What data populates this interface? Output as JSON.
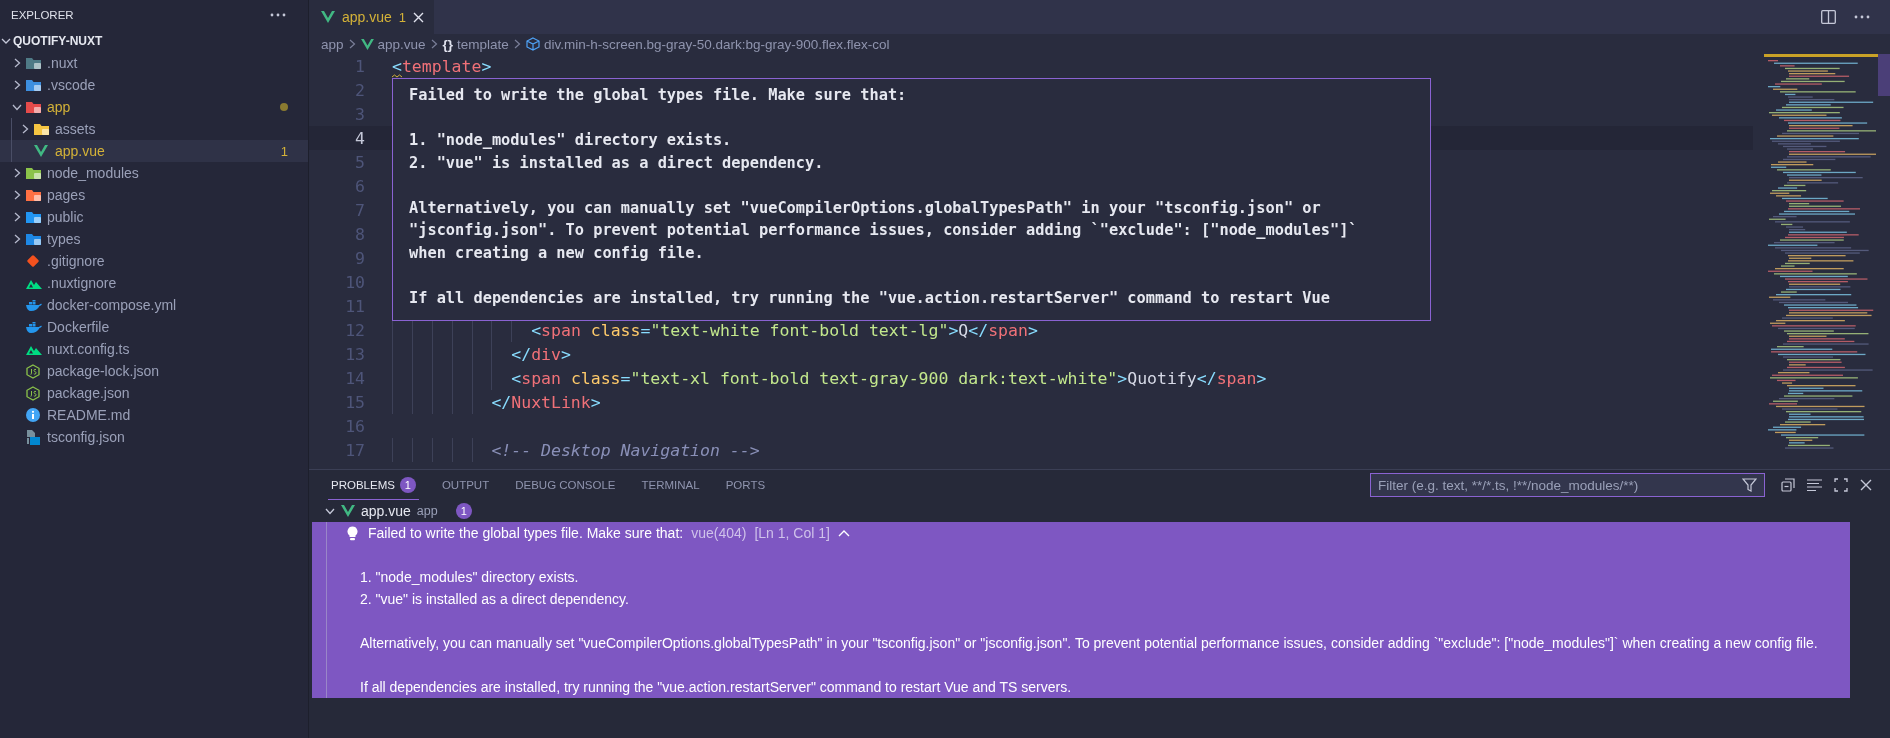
{
  "sidebar": {
    "title": "EXPLORER",
    "root": {
      "label": "QUOTIFY-NUXT",
      "expanded": true
    },
    "items": [
      {
        "label": ".nuxt",
        "kind": "folder",
        "expanded": false,
        "selected": false,
        "warning": false
      },
      {
        "label": ".vscode",
        "kind": "folder",
        "expanded": false,
        "selected": false,
        "warning": false
      },
      {
        "label": "app",
        "kind": "folder",
        "expanded": true,
        "selected": false,
        "warning": true,
        "children": [
          {
            "label": "assets",
            "kind": "folder",
            "expanded": false,
            "selected": false,
            "warning": false
          },
          {
            "label": "app.vue",
            "kind": "file",
            "selected": true,
            "warning": true,
            "badge": "1"
          }
        ]
      },
      {
        "label": "node_modules",
        "kind": "folder",
        "expanded": false,
        "selected": false,
        "warning": false
      },
      {
        "label": "pages",
        "kind": "folder",
        "expanded": false,
        "selected": false,
        "warning": false
      },
      {
        "label": "public",
        "kind": "folder",
        "expanded": false,
        "selected": false,
        "warning": false
      },
      {
        "label": "types",
        "kind": "folder",
        "expanded": false,
        "selected": false,
        "warning": false
      },
      {
        "label": ".gitignore",
        "kind": "file",
        "selected": false,
        "warning": false
      },
      {
        "label": ".nuxtignore",
        "kind": "file",
        "selected": false,
        "warning": false
      },
      {
        "label": "docker-compose.yml",
        "kind": "file",
        "selected": false,
        "warning": false
      },
      {
        "label": "Dockerfile",
        "kind": "file",
        "selected": false,
        "warning": false
      },
      {
        "label": "nuxt.config.ts",
        "kind": "file",
        "selected": false,
        "warning": false
      },
      {
        "label": "package-lock.json",
        "kind": "file",
        "selected": false,
        "warning": false
      },
      {
        "label": "package.json",
        "kind": "file",
        "selected": false,
        "warning": false
      },
      {
        "label": "README.md",
        "kind": "file",
        "selected": false,
        "warning": false
      },
      {
        "label": "tsconfig.json",
        "kind": "file",
        "selected": false,
        "warning": false
      }
    ]
  },
  "tabs": [
    {
      "label": "app.vue",
      "badge": "1",
      "selected": true,
      "warning": true
    }
  ],
  "breadcrumbs": [
    {
      "label": "app"
    },
    {
      "label": "app.vue"
    },
    {
      "glyph": "{}",
      "label": "template"
    },
    {
      "label": "div.min-h-screen.bg-gray-50.dark:bg-gray-900.flex.flex-col"
    }
  ],
  "code_lines": [
    {
      "number": "1",
      "current": false,
      "tokens": [
        {
          "kind": "punct",
          "text": "<"
        },
        {
          "kind": "tag",
          "text": "template"
        },
        {
          "kind": "punct",
          "text": ">"
        }
      ]
    },
    {
      "number": "2",
      "current": false
    },
    {
      "number": "3",
      "current": false
    },
    {
      "number": "4",
      "current": true
    },
    {
      "number": "5",
      "current": false
    },
    {
      "number": "6",
      "current": false
    },
    {
      "number": "7",
      "current": false
    },
    {
      "number": "8",
      "current": false
    },
    {
      "number": "9",
      "current": false
    },
    {
      "number": "10",
      "current": false
    },
    {
      "number": "11",
      "current": false
    },
    {
      "number": "12",
      "current": false,
      "tokens": [
        {
          "kind": "punct",
          "text": "<"
        },
        {
          "kind": "tag",
          "text": "span"
        },
        {
          "kind": "attr",
          "text": " class"
        },
        {
          "kind": "punct",
          "text": "="
        },
        {
          "kind": "string",
          "text": "\"text-white font-bold text-lg\""
        },
        {
          "kind": "punct",
          "text": ">"
        },
        {
          "kind": "plain",
          "text": "Q"
        },
        {
          "kind": "punct",
          "text": "</"
        },
        {
          "kind": "tag",
          "text": "span"
        },
        {
          "kind": "punct",
          "text": ">"
        }
      ]
    },
    {
      "number": "13",
      "current": false,
      "tokens": [
        {
          "kind": "punct",
          "text": "</"
        },
        {
          "kind": "tag",
          "text": "div"
        },
        {
          "kind": "punct",
          "text": ">"
        }
      ]
    },
    {
      "number": "14",
      "current": false,
      "tokens": [
        {
          "kind": "punct",
          "text": "<"
        },
        {
          "kind": "tag",
          "text": "span"
        },
        {
          "kind": "attr",
          "text": " class"
        },
        {
          "kind": "punct",
          "text": "="
        },
        {
          "kind": "string",
          "text": "\"text-xl font-bold text-gray-900 dark:text-white\""
        },
        {
          "kind": "punct",
          "text": ">"
        },
        {
          "kind": "plain",
          "text": "Quotify"
        },
        {
          "kind": "punct",
          "text": "</"
        },
        {
          "kind": "tag",
          "text": "span"
        },
        {
          "kind": "punct",
          "text": ">"
        }
      ]
    },
    {
      "number": "15",
      "current": false,
      "tokens": [
        {
          "kind": "punct",
          "text": "</"
        },
        {
          "kind": "tag",
          "text": "NuxtLink"
        },
        {
          "kind": "punct",
          "text": ">"
        }
      ]
    },
    {
      "number": "16",
      "current": false
    },
    {
      "number": "17",
      "current": false,
      "tokens": [
        {
          "kind": "comment",
          "text": "<!-- Desktop Navigation -->"
        }
      ]
    }
  ],
  "hover": {
    "paragraphs": [
      [
        "Failed to write the global types file. Make sure that:"
      ],
      [
        "1. \"node_modules\" directory exists.",
        "2. \"vue\" is installed as a direct dependency."
      ],
      [
        "Alternatively, you can manually set \"vueCompilerOptions.globalTypesPath\" in your \"tsconfig.json\" or",
        "\"jsconfig.json\". To prevent potential performance issues, consider adding `\"exclude\": [\"node_modules\"]`",
        "when creating a new config file."
      ],
      [
        "If all dependencies are installed, try running the \"vue.action.restartServer\" command to restart Vue"
      ]
    ]
  },
  "panel": {
    "tabs": [
      {
        "label": "PROBLEMS",
        "badge": "1",
        "selected": true
      },
      {
        "label": "OUTPUT",
        "selected": false
      },
      {
        "label": "DEBUG CONSOLE",
        "selected": false
      },
      {
        "label": "TERMINAL",
        "selected": false
      },
      {
        "label": "PORTS",
        "selected": false
      }
    ],
    "filter": {
      "placeholder": "Filter (e.g. text, **/*.ts, !**/node_modules/**)"
    },
    "files": [
      {
        "name": "app.vue",
        "folder": "app",
        "count": "1",
        "expanded": true,
        "problems": [
          {
            "selected": true,
            "expanded": true,
            "source": "vue(404)",
            "location": "[Ln 1, Col 1]",
            "paragraphs": [
              [
                "Failed to write the global types file. Make sure that:"
              ],
              [
                "1. \"node_modules\" directory exists.",
                "2. \"vue\" is installed as a direct dependency."
              ],
              [
                "Alternatively, you can manually set \"vueCompilerOptions.globalTypesPath\" in your \"tsconfig.json\" or \"jsconfig.json\". To prevent potential performance issues, consider adding `\"exclude\": [\"node_modules\"]` when creating a new config file."
              ],
              [
                "If all dependencies are installed, try running the \"vue.action.restartServer\" command to restart Vue and TS servers."
              ]
            ]
          }
        ]
      }
    ]
  }
}
